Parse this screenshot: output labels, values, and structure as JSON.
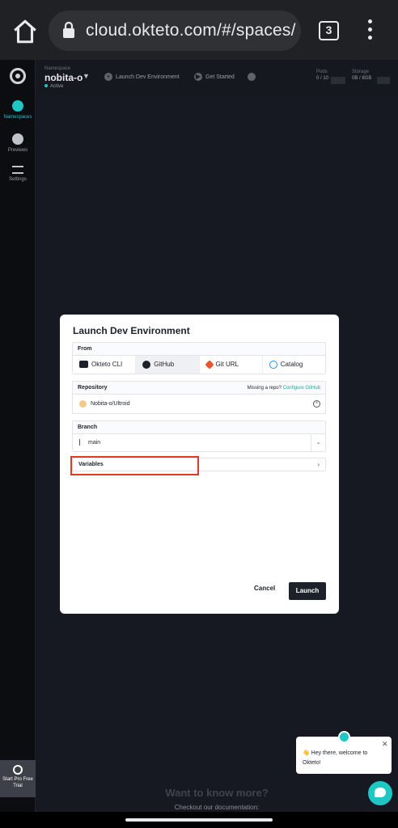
{
  "browser": {
    "url": "cloud.okteto.com/#/spaces/",
    "tab_count": "3"
  },
  "sidebar": {
    "items": [
      {
        "label": "Namespaces",
        "icon": "namespaces-icon",
        "active": true
      },
      {
        "label": "Previews",
        "icon": "previews-icon",
        "active": false
      },
      {
        "label": "Settings",
        "icon": "settings-icon",
        "active": false
      }
    ],
    "pro": "Start Pro Free Trial"
  },
  "topnav": {
    "namespace_label": "Namespace",
    "namespace_name": "nobita-o",
    "namespace_status": "Active",
    "launch_label": "Launch Dev Environment",
    "get_started_label": "Get Started",
    "pods_label": "Pods",
    "pods_value": "0 / 10",
    "storage_label": "Storage",
    "storage_value": "0B / 8GB"
  },
  "modal": {
    "title": "Launch Dev Environment",
    "from_label": "From",
    "from_tabs": [
      {
        "label": "Okteto CLI",
        "icon": "terminal-icon"
      },
      {
        "label": "GitHub",
        "icon": "github-icon"
      },
      {
        "label": "Git URL",
        "icon": "git-icon"
      },
      {
        "label": "Catalog",
        "icon": "helm-icon"
      }
    ],
    "repository_label": "Repository",
    "missing_repo": "Missing a repo?",
    "configure_github": "Configure GitHub",
    "repository_value": "Nobita-o/Ultroid",
    "branch_label": "Branch",
    "branch_value": "main",
    "variables_label": "Variables",
    "cancel_label": "Cancel",
    "launch_label": "Launch"
  },
  "background": {
    "more_title": "Want to know more?",
    "more_sub": "Checkout our documentation:"
  },
  "chat": {
    "message": "👋 Hey there, welcome to Okteto!"
  },
  "colors": {
    "accent": "#1fc7c4",
    "highlight": "#e0391f",
    "primary_button": "#1d2129"
  }
}
